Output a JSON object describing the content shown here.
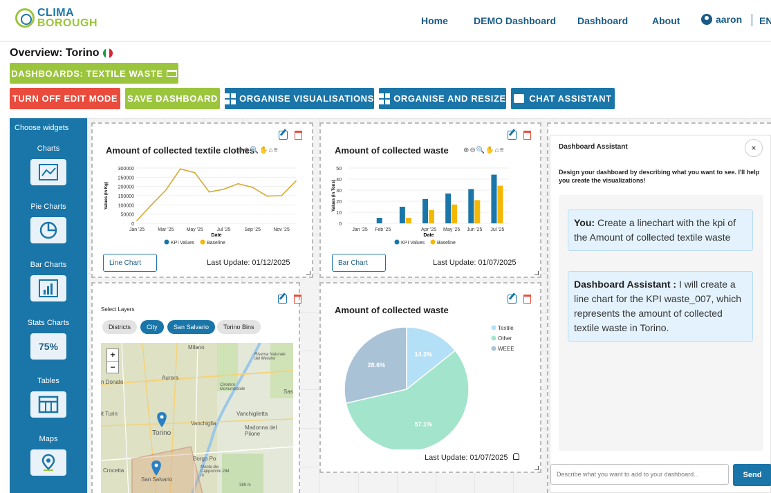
{
  "header": {
    "logo_line1": "CLIMA",
    "logo_line2": "BOROUGH",
    "nav": [
      "Home",
      "DEMO Dashboard",
      "Dashboard",
      "About"
    ],
    "user": "aaron",
    "lang": "EN"
  },
  "page": {
    "overview_title": "Overview: Torino",
    "dashboards_button": "DASHBOARDS: TEXTILE WASTE"
  },
  "toolbar": {
    "turn_off_edit": "TURN OFF EDIT MODE",
    "save": "SAVE DASHBOARD",
    "organise_vis": "ORGANISE VISUALISATIONS",
    "organise_resize": "ORGANISE AND RESIZE",
    "chat": "CHAT ASSISTANT"
  },
  "sidebar": {
    "title": "Choose widgets",
    "items": [
      {
        "label": "Charts",
        "icon": "line-chart-icon"
      },
      {
        "label": "Pie Charts",
        "icon": "pie-chart-icon"
      },
      {
        "label": "Bar Charts",
        "icon": "bar-chart-icon"
      },
      {
        "label": "Stats Charts",
        "icon": "percent-icon",
        "value": "75%"
      },
      {
        "label": "Tables",
        "icon": "table-icon"
      },
      {
        "label": "Maps",
        "icon": "map-pin-icon"
      }
    ]
  },
  "widgets": {
    "line": {
      "title": "Amount of collected textile clothes",
      "type_label": "Line Chart",
      "last_update": "Last Update: 01/12/2025"
    },
    "bar": {
      "title": "Amount of collected waste",
      "type_label": "Bar Chart",
      "last_update": "Last Update: 01/07/2025"
    },
    "map": {
      "select_layers": "Select Layers",
      "layers": [
        {
          "label": "Districts",
          "active": false
        },
        {
          "label": "City",
          "active": true
        },
        {
          "label": "San Salvario",
          "active": true
        },
        {
          "label": "Torino Bins",
          "active": false
        }
      ],
      "place_labels": [
        "Milano",
        "Aurora",
        "n Donato",
        "it Turin",
        "Vanchiglia",
        "Vanchiglietta",
        "Torino",
        "Madonna del Pilone",
        "Borgo Po",
        "Crocetta",
        "San Salvario",
        "Cimitero Monumentale",
        "Riserva Naturale del Meisino",
        "Monte dei Cappuccini 284 m",
        "389 m",
        "Sas"
      ],
      "zoom_in": "+",
      "zoom_out": "−"
    },
    "pie": {
      "title": "Amount of collected waste",
      "last_update": "Last Update: 01/07/2025"
    }
  },
  "chart_data": [
    {
      "type": "line",
      "title": "Amount of collected textile clothes",
      "xlabel": "Date",
      "ylabel": "Values (in Kg)",
      "x": [
        "Jan '25",
        "Feb '25",
        "Mar '25",
        "Apr '25",
        "May '25",
        "Jun '25",
        "Jul '25",
        "Aug '25",
        "Sep '25",
        "Oct '25",
        "Nov '25",
        "Dec '25"
      ],
      "x_tick_labels": [
        "Jan '25",
        "Mar '25",
        "May '25",
        "Jul '25",
        "Sep '25",
        "Nov '25"
      ],
      "y_ticks": [
        0,
        50000,
        100000,
        150000,
        200000,
        250000,
        300000
      ],
      "ylim": [
        0,
        300000
      ],
      "series": [
        {
          "name": "KPI Values",
          "color": "#d4a933",
          "values": [
            15000,
            100000,
            180000,
            295000,
            275000,
            170000,
            185000,
            215000,
            195000,
            148000,
            150000,
            230000
          ]
        },
        {
          "name": "Baseline",
          "color": "#f5b800",
          "values": []
        }
      ],
      "legend": [
        "KPI Values",
        "Baseline"
      ],
      "legend_position": "bottom"
    },
    {
      "type": "bar",
      "title": "Amount of collected waste",
      "xlabel": "Date",
      "ylabel": "Values (in Tons)",
      "categories": [
        "Jan '25",
        "Feb '25",
        "Mar '25",
        "Apr '25",
        "May '25",
        "Jun '25",
        "Jul '25"
      ],
      "x_tick_labels": [
        "Jan '25",
        "Feb '25",
        "",
        "Apr '25",
        "May '25",
        "Jun '25",
        "Jul '25"
      ],
      "y_ticks": [
        0,
        10,
        20,
        30,
        40,
        50
      ],
      "ylim": [
        0,
        50
      ],
      "series": [
        {
          "name": "KPI Values",
          "color": "#1a75a8",
          "values": [
            0,
            5,
            15,
            22,
            27,
            31,
            44
          ]
        },
        {
          "name": "Baseline",
          "color": "#f5b800",
          "values": [
            0,
            0,
            5,
            12,
            17,
            21,
            34
          ]
        }
      ],
      "legend": [
        "KPI Values",
        "Baseline"
      ],
      "legend_position": "bottom"
    },
    {
      "type": "pie",
      "title": "Amount of collected waste",
      "slices": [
        {
          "name": "Textile",
          "value": 14.3,
          "label": "14.3%",
          "color": "#b3e0f7"
        },
        {
          "name": "Other",
          "value": 57.1,
          "label": "57.1%",
          "color": "#a3e4cc"
        },
        {
          "name": "WEEE",
          "value": 28.6,
          "label": "28.6%",
          "color": "#a9c2d6"
        }
      ],
      "legend_position": "top-right"
    }
  ],
  "assistant": {
    "title": "Dashboard Assistant",
    "close": "×",
    "intro": "Design your dashboard by describing what you want to see. I'll help you create the visualizations!",
    "messages": [
      {
        "speaker": "You:",
        "text": " Create a linechart with the kpi of the Amount of collected textile waste"
      },
      {
        "speaker": "Dashboard Assistant :",
        "text": " I will create a line chart for the KPI waste_007, which represents the amount of collected textile waste in Torino."
      }
    ],
    "input_placeholder": "Describe what you want to add to your dashboard...",
    "send": "Send"
  }
}
